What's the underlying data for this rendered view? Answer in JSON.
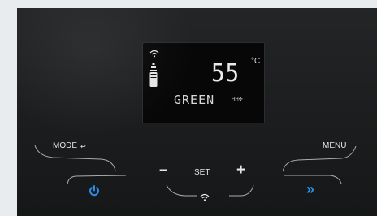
{
  "display": {
    "temperature": "55",
    "unit": "°C",
    "mode_text": "GREEN",
    "mode_icon": "HH✣"
  },
  "controls": {
    "mode_label": "MODE",
    "mode_arrow": "↩",
    "menu_label": "MENU",
    "set_label": "SET",
    "minus_label": "−",
    "plus_label": "+",
    "forward_label": "»"
  },
  "colors": {
    "panel": "#1f2021",
    "accent_blue": "#2b8ee6",
    "lcd_text": "#eaeaea"
  },
  "icons": [
    "wifi-icon",
    "tank-level-icon",
    "power-icon",
    "wifi-button-icon"
  ]
}
